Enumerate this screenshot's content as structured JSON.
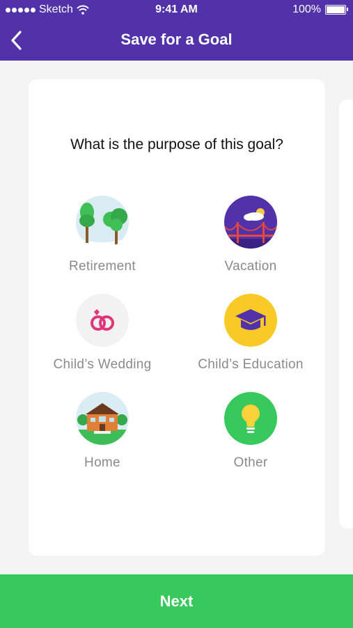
{
  "status_bar": {
    "carrier": "Sketch",
    "time": "9:41 AM",
    "battery": "100%"
  },
  "nav": {
    "title": "Save for a Goal"
  },
  "question": "What is the purpose of this goal?",
  "goals": [
    {
      "label": "Retirement",
      "icon": "trees-icon"
    },
    {
      "label": "Vacation",
      "icon": "bridge-icon"
    },
    {
      "label": "Child’s Wedding",
      "icon": "rings-icon"
    },
    {
      "label": "Child’s Education",
      "icon": "graduation-cap-icon"
    },
    {
      "label": "Home",
      "icon": "house-icon"
    },
    {
      "label": "Other",
      "icon": "lightbulb-icon"
    }
  ],
  "next_label": "Next",
  "colors": {
    "header": "#5232a8",
    "next_button": "#37c95b",
    "label_text": "#8a8a8a"
  }
}
